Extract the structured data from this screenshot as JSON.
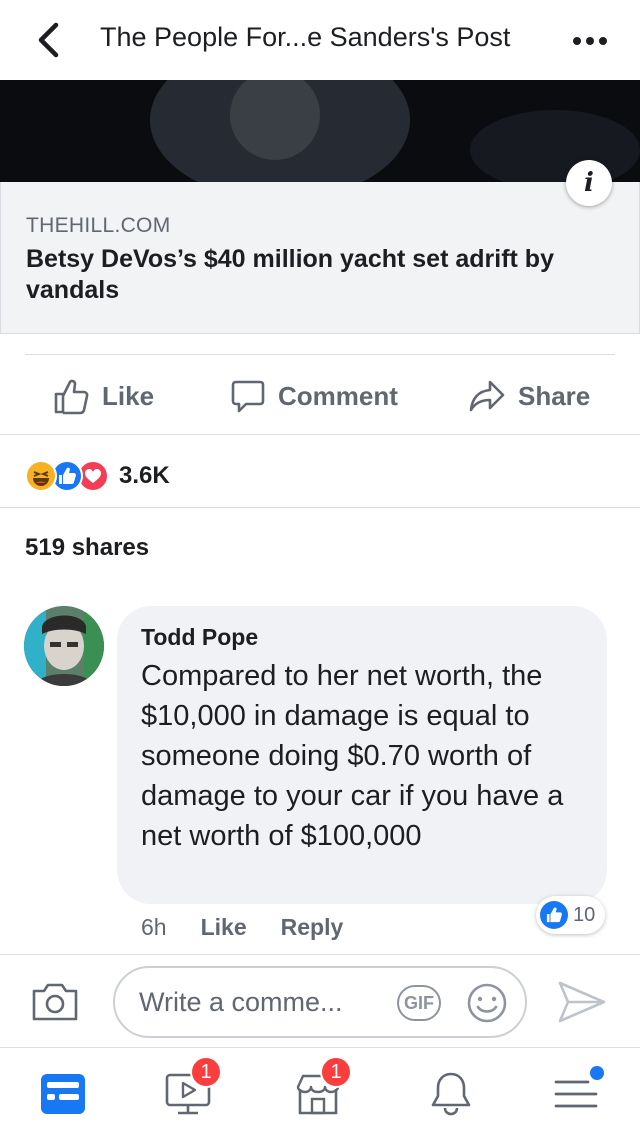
{
  "header": {
    "title": "The People For...e Sanders's Post",
    "back_icon": "chevron-left-icon",
    "more_icon": "more-horizontal-icon"
  },
  "link_preview": {
    "source": "THEHILL.COM",
    "title": "Betsy DeVos’s $40 million yacht set adrift by vandals",
    "info_icon": "info-icon"
  },
  "actions": {
    "like_label": "Like",
    "comment_label": "Comment",
    "share_label": "Share"
  },
  "reactions": {
    "types": [
      "haha",
      "like",
      "love"
    ],
    "count": "3.6K"
  },
  "shares": {
    "text": "519 shares"
  },
  "comment": {
    "author": "Todd Pope",
    "text": "Compared to her net worth, the $10,000 in damage is equal to someone doing $0.70 worth of damage to your car if you have a net worth of $100,000",
    "time": "6h",
    "like_label": "Like",
    "reply_label": "Reply",
    "like_count": "10"
  },
  "composer": {
    "placeholder": "Write a comme...",
    "gif_label": "GIF"
  },
  "tabbar": {
    "items": [
      {
        "name": "news-feed",
        "icon": "news-feed-icon",
        "badge": ""
      },
      {
        "name": "watch",
        "icon": "watch-video-icon",
        "badge": "1"
      },
      {
        "name": "marketplace",
        "icon": "marketplace-icon",
        "badge": "1"
      },
      {
        "name": "notifications",
        "icon": "bell-icon",
        "badge": ""
      },
      {
        "name": "menu",
        "icon": "menu-icon",
        "badge": ""
      }
    ]
  },
  "colors": {
    "accent": "#1877f2",
    "badge": "#fa3e3e",
    "secondary_text": "#606770",
    "bubble": "#f0f2f5"
  }
}
